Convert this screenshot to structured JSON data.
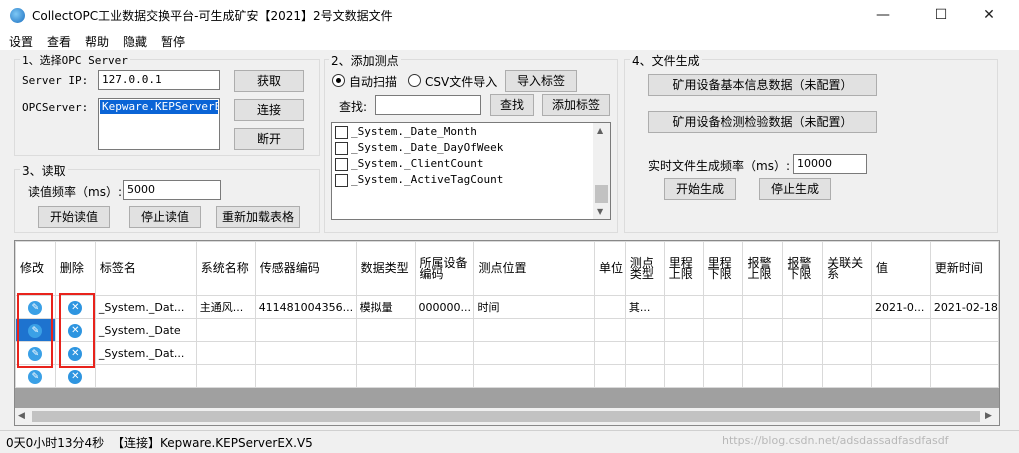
{
  "window": {
    "title": "CollectOPC工业数据交换平台-可生成矿安【2021】2号文数据文件",
    "minimize": "—",
    "maximize": "☐",
    "close": "✕"
  },
  "menu": [
    "设置",
    "查看",
    "帮助",
    "隐藏",
    "暂停"
  ],
  "opc_server": {
    "title": "1、选择OPC Server",
    "ip_label": "Server IP:",
    "ip_value": "127.0.0.1",
    "server_label": "OPCServer:",
    "server_list": [
      "Kepware.KEPServerEX"
    ],
    "get_btn": "获取",
    "connect_btn": "连接",
    "disconnect_btn": "断开"
  },
  "read": {
    "title": "3、读取",
    "freq_label": "读值频率（ms）:",
    "freq_value": "5000",
    "start_btn": "开始读值",
    "stop_btn": "停止读值",
    "reload_btn": "重新加载表格"
  },
  "points": {
    "title": "2、添加测点",
    "auto_scan": "自动扫描",
    "csv_import": "CSV文件导入",
    "import_btn": "导入标签",
    "search_label": "查找:",
    "search_value": "",
    "search_btn": "查找",
    "add_btn": "添加标签",
    "tags": [
      "_System._Date_Month",
      "_System._Date_DayOfWeek",
      "_System._ClientCount",
      "_System._ActiveTagCount"
    ]
  },
  "file_gen": {
    "title": "4、文件生成",
    "basic_btn": "矿用设备基本信息数据（未配置）",
    "inspect_btn": "矿用设备检测检验数据（未配置）",
    "freq_label": "实时文件生成频率（ms）:",
    "freq_value": "10000",
    "start_btn": "开始生成",
    "stop_btn": "停止生成"
  },
  "grid": {
    "headers": [
      "修改",
      "删除",
      "标签名",
      "系统名称",
      "传感器编码",
      "数据类型",
      "所属设备编码",
      "测点位置",
      "单位",
      "测点类型",
      "里程上限",
      "里程下限",
      "报警上限",
      "报警下限",
      "关联关系",
      "值",
      "更新时间"
    ],
    "rows": [
      [
        "_System._Dat...",
        "主通风...",
        "411481004356...",
        "模拟量",
        "000000...",
        "时间",
        "",
        "其...",
        "",
        "",
        "",
        "",
        "",
        "2021-0...",
        "2021-02-18"
      ],
      [
        "_System._Date",
        "",
        "",
        "",
        "",
        "",
        "",
        "",
        "",
        "",
        "",
        "",
        "",
        "",
        ""
      ],
      [
        "_System._Dat...",
        "",
        "",
        "",
        "",
        "",
        "",
        "",
        "",
        "",
        "",
        "",
        "",
        "",
        ""
      ],
      [
        "",
        "",
        "",
        "",
        "",
        "",
        "",
        "",
        "",
        "",
        "",
        "",
        "",
        "",
        ""
      ]
    ],
    "edit_icon": "✎",
    "delete_icon": "✕"
  },
  "status": {
    "uptime": "0天0小时13分4秒",
    "connection": "【连接】Kepware.KEPServerEX.V5",
    "watermark": "https://blog.csdn.net/adsdassadfasdfasdf"
  }
}
